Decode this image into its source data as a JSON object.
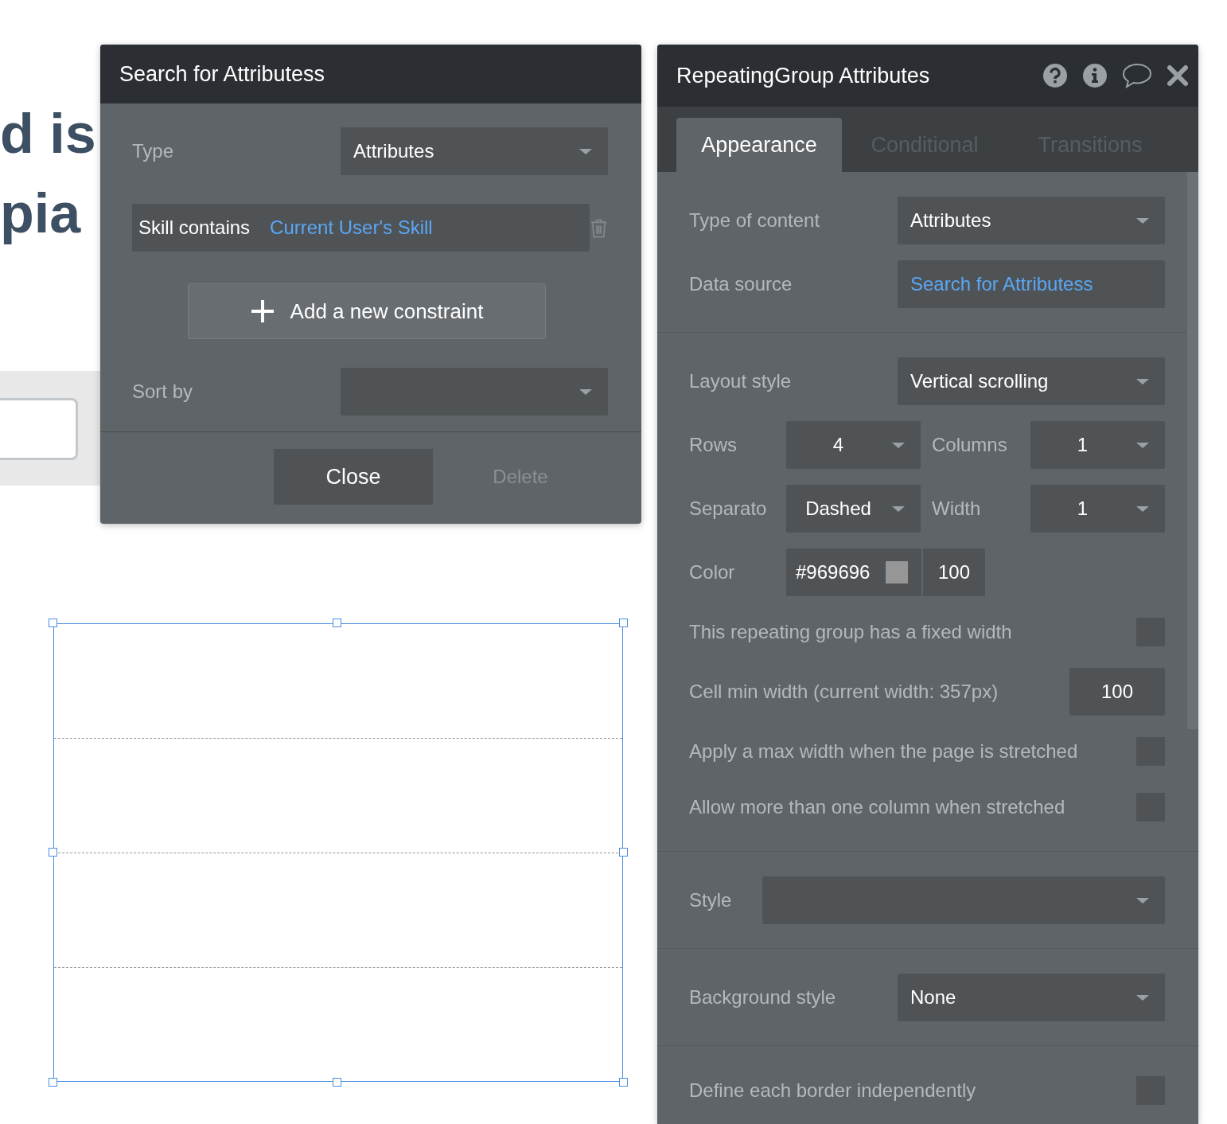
{
  "canvas": {
    "heading_lines": [
      "d is",
      "pia"
    ]
  },
  "search_dialog": {
    "title": "Search for Attributess",
    "type": {
      "label": "Type",
      "value": "Attributes"
    },
    "constraint": {
      "field": "Skill contains",
      "value": "Current User's Skill"
    },
    "add_button": {
      "label": "Add a new constraint"
    },
    "sort": {
      "label": "Sort by"
    },
    "buttons": [
      {
        "label": "Close",
        "disabled": false
      },
      {
        "label": "Delete",
        "disabled": true
      }
    ]
  },
  "attributes_panel": {
    "title": "RepeatingGroup Attributes",
    "tabs": [
      {
        "label": "Appearance",
        "selected": true
      },
      {
        "label": "Conditional",
        "selected": false
      },
      {
        "label": "Transitions",
        "selected": false
      }
    ],
    "sections": [
      {
        "rows": [
          {
            "kind": "dropdown",
            "label": "Type of content",
            "value": "Attributes"
          },
          {
            "kind": "link",
            "label": "Data source",
            "value": "Search for Attributess"
          }
        ]
      },
      {
        "rows": [
          {
            "kind": "dropdown",
            "label": "Layout style",
            "value": "Vertical scrolling"
          },
          {
            "kind": "pair",
            "label": "Rows",
            "value": "4",
            "label2": "Columns",
            "value2": "1"
          },
          {
            "kind": "pair",
            "label": "Separato",
            "value": "Dashed",
            "label2": "Width",
            "value2": "1"
          },
          {
            "kind": "color",
            "label": "Color",
            "value": "#969696",
            "color": "#969696",
            "opacity": "100"
          },
          {
            "kind": "checkbox",
            "label": "This repeating group has a fixed width",
            "checked": false
          },
          {
            "kind": "number",
            "label": "Cell min width (current width: 357px)",
            "value": "100"
          },
          {
            "kind": "checkbox",
            "label": "Apply a max width when the page is stretched",
            "checked": false
          },
          {
            "kind": "checkbox",
            "label": "Allow more than one column when stretched",
            "checked": false
          }
        ]
      },
      {
        "rows": [
          {
            "kind": "wide_dropdown",
            "label": "Style"
          }
        ]
      },
      {
        "rows": [
          {
            "kind": "dropdown",
            "label": "Background style",
            "value": "None"
          }
        ]
      },
      {
        "rows": [
          {
            "kind": "checkbox",
            "label": "Define each border independently",
            "checked": false
          }
        ]
      }
    ]
  }
}
